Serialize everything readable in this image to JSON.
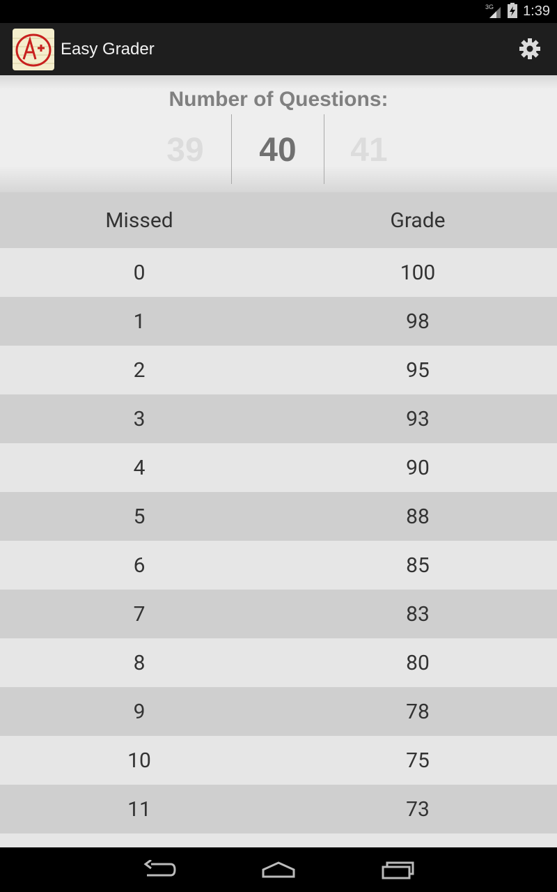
{
  "status_bar": {
    "network_label": "3G",
    "time": "1:39",
    "icons": [
      "signal-icon",
      "battery-icon"
    ]
  },
  "action_bar": {
    "title": "Easy Grader",
    "icon_name": "a-plus-app-icon",
    "settings_icon": "gear-icon"
  },
  "picker": {
    "label": "Number of Questions:",
    "previous": "39",
    "current": "40",
    "next": "41"
  },
  "table": {
    "headers": {
      "missed": "Missed",
      "grade": "Grade"
    },
    "rows": [
      {
        "missed": "0",
        "grade": "100"
      },
      {
        "missed": "1",
        "grade": "98"
      },
      {
        "missed": "2",
        "grade": "95"
      },
      {
        "missed": "3",
        "grade": "93"
      },
      {
        "missed": "4",
        "grade": "90"
      },
      {
        "missed": "5",
        "grade": "88"
      },
      {
        "missed": "6",
        "grade": "85"
      },
      {
        "missed": "7",
        "grade": "83"
      },
      {
        "missed": "8",
        "grade": "80"
      },
      {
        "missed": "9",
        "grade": "78"
      },
      {
        "missed": "10",
        "grade": "75"
      },
      {
        "missed": "11",
        "grade": "73"
      }
    ]
  },
  "nav_bar": {
    "buttons": [
      "back-icon",
      "home-icon",
      "recents-icon"
    ]
  },
  "colors": {
    "action_bar": "#1e1e1e",
    "row_light": "#e6e6e6",
    "row_dark": "#cfcfcf",
    "app_icon_red": "#c8201e"
  }
}
